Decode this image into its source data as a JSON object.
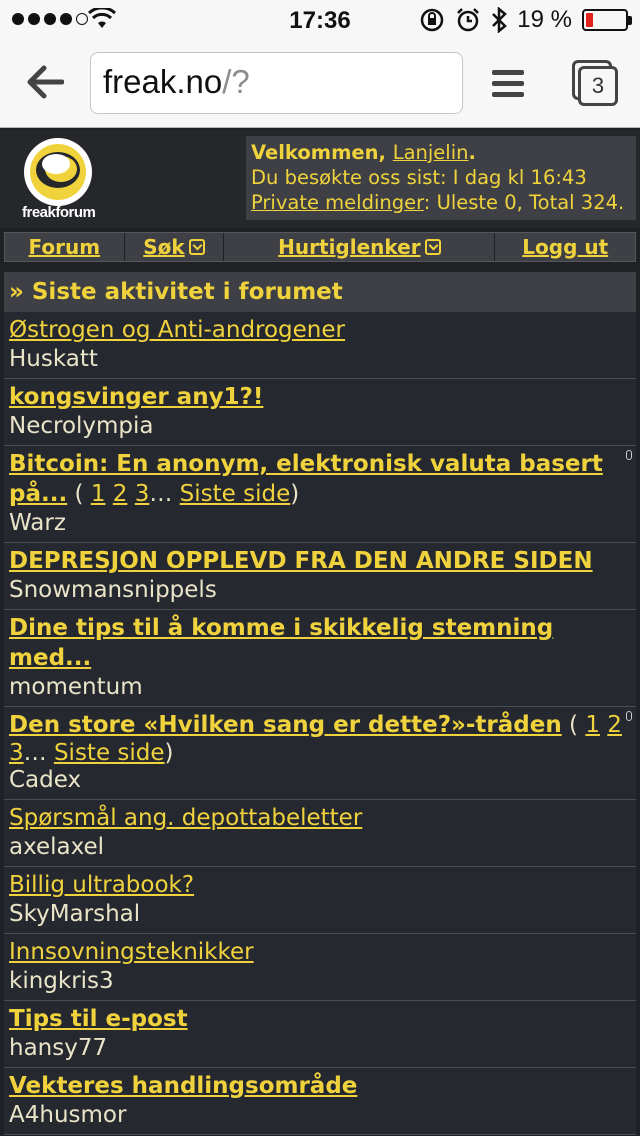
{
  "status_bar": {
    "time": "17:36",
    "battery": "19 %",
    "battery_level": 0.19
  },
  "browser": {
    "url_host": "freak.no",
    "url_path": "/?",
    "tab_count": "3"
  },
  "site": {
    "logo_text_a": "freak",
    "logo_text_b": "forum"
  },
  "welcome": {
    "greeting": "Velkommen, ",
    "username": "Lanjelin",
    "greeting_end": ".",
    "last_visit": "Du besøkte oss sist: I dag kl 16:43",
    "pm_link": "Private meldinger",
    "pm_status": ": Uleste 0, Total 324."
  },
  "menu": {
    "forum": "Forum",
    "search": "Søk",
    "quicklinks": "Hurtiglenker",
    "logout": "Logg ut"
  },
  "activity": {
    "title": "» Siste aktivitet i forumet",
    "items": [
      {
        "title": "Østrogen og Anti-androgener",
        "bold": false,
        "user": "Huskatt"
      },
      {
        "title": "kongsvinger any1?!",
        "bold": true,
        "user": "Necrolympia"
      },
      {
        "title": "Bitcoin: En anonym, elektronisk valuta basert på...",
        "bold": true,
        "user": "Warz",
        "pages": [
          "1",
          "2",
          "3"
        ],
        "last_page": "Siste side",
        "attachment": true
      },
      {
        "title": "DEPRESJON OPPLEVD FRA DEN ANDRE SIDEN",
        "bold": true,
        "user": "Snowmansnippels"
      },
      {
        "title": "Dine tips til å komme i skikkelig stemning med...",
        "bold": true,
        "user": "momentum"
      },
      {
        "title": "Den store «Hvilken sang er dette?»-tråden",
        "bold": true,
        "user": "Cadex",
        "pages": [
          "1",
          "2",
          "3"
        ],
        "last_page": "Siste side",
        "attachment": true
      },
      {
        "title": "Spørsmål ang. depottabeletter",
        "bold": false,
        "user": "axelaxel"
      },
      {
        "title": "Billig ultrabook?",
        "bold": false,
        "user": "SkyMarshal"
      },
      {
        "title": "Innsovningsteknikker",
        "bold": false,
        "user": "kingkris3"
      },
      {
        "title": "Tips til e-post",
        "bold": true,
        "user": "hansy77"
      },
      {
        "title": "Vekteres handlingsområde",
        "bold": true,
        "user": "A4husmor"
      }
    ]
  }
}
